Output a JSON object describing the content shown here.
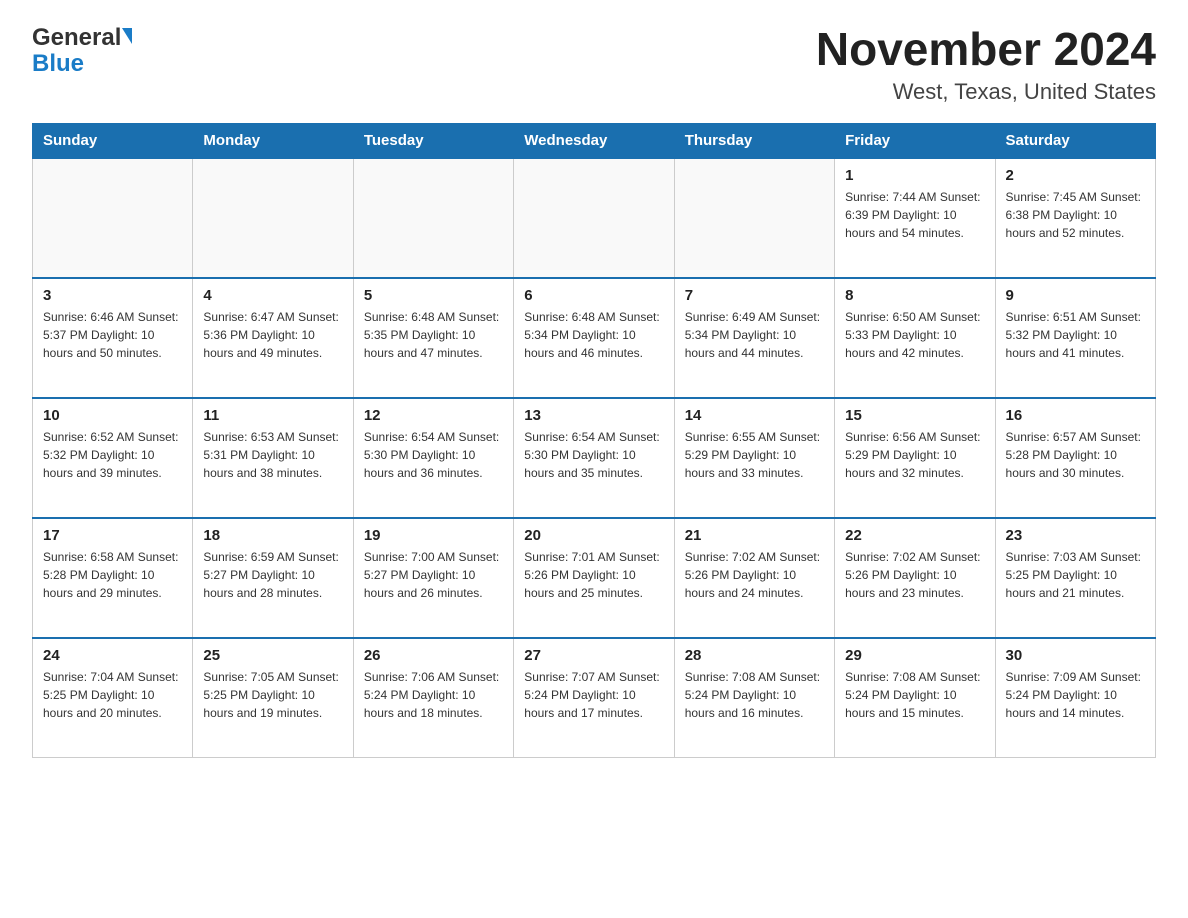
{
  "logo": {
    "general": "General",
    "blue": "Blue"
  },
  "title": "November 2024",
  "location": "West, Texas, United States",
  "days_of_week": [
    "Sunday",
    "Monday",
    "Tuesday",
    "Wednesday",
    "Thursday",
    "Friday",
    "Saturday"
  ],
  "weeks": [
    [
      {
        "day": "",
        "info": ""
      },
      {
        "day": "",
        "info": ""
      },
      {
        "day": "",
        "info": ""
      },
      {
        "day": "",
        "info": ""
      },
      {
        "day": "",
        "info": ""
      },
      {
        "day": "1",
        "info": "Sunrise: 7:44 AM\nSunset: 6:39 PM\nDaylight: 10 hours and 54 minutes."
      },
      {
        "day": "2",
        "info": "Sunrise: 7:45 AM\nSunset: 6:38 PM\nDaylight: 10 hours and 52 minutes."
      }
    ],
    [
      {
        "day": "3",
        "info": "Sunrise: 6:46 AM\nSunset: 5:37 PM\nDaylight: 10 hours and 50 minutes."
      },
      {
        "day": "4",
        "info": "Sunrise: 6:47 AM\nSunset: 5:36 PM\nDaylight: 10 hours and 49 minutes."
      },
      {
        "day": "5",
        "info": "Sunrise: 6:48 AM\nSunset: 5:35 PM\nDaylight: 10 hours and 47 minutes."
      },
      {
        "day": "6",
        "info": "Sunrise: 6:48 AM\nSunset: 5:34 PM\nDaylight: 10 hours and 46 minutes."
      },
      {
        "day": "7",
        "info": "Sunrise: 6:49 AM\nSunset: 5:34 PM\nDaylight: 10 hours and 44 minutes."
      },
      {
        "day": "8",
        "info": "Sunrise: 6:50 AM\nSunset: 5:33 PM\nDaylight: 10 hours and 42 minutes."
      },
      {
        "day": "9",
        "info": "Sunrise: 6:51 AM\nSunset: 5:32 PM\nDaylight: 10 hours and 41 minutes."
      }
    ],
    [
      {
        "day": "10",
        "info": "Sunrise: 6:52 AM\nSunset: 5:32 PM\nDaylight: 10 hours and 39 minutes."
      },
      {
        "day": "11",
        "info": "Sunrise: 6:53 AM\nSunset: 5:31 PM\nDaylight: 10 hours and 38 minutes."
      },
      {
        "day": "12",
        "info": "Sunrise: 6:54 AM\nSunset: 5:30 PM\nDaylight: 10 hours and 36 minutes."
      },
      {
        "day": "13",
        "info": "Sunrise: 6:54 AM\nSunset: 5:30 PM\nDaylight: 10 hours and 35 minutes."
      },
      {
        "day": "14",
        "info": "Sunrise: 6:55 AM\nSunset: 5:29 PM\nDaylight: 10 hours and 33 minutes."
      },
      {
        "day": "15",
        "info": "Sunrise: 6:56 AM\nSunset: 5:29 PM\nDaylight: 10 hours and 32 minutes."
      },
      {
        "day": "16",
        "info": "Sunrise: 6:57 AM\nSunset: 5:28 PM\nDaylight: 10 hours and 30 minutes."
      }
    ],
    [
      {
        "day": "17",
        "info": "Sunrise: 6:58 AM\nSunset: 5:28 PM\nDaylight: 10 hours and 29 minutes."
      },
      {
        "day": "18",
        "info": "Sunrise: 6:59 AM\nSunset: 5:27 PM\nDaylight: 10 hours and 28 minutes."
      },
      {
        "day": "19",
        "info": "Sunrise: 7:00 AM\nSunset: 5:27 PM\nDaylight: 10 hours and 26 minutes."
      },
      {
        "day": "20",
        "info": "Sunrise: 7:01 AM\nSunset: 5:26 PM\nDaylight: 10 hours and 25 minutes."
      },
      {
        "day": "21",
        "info": "Sunrise: 7:02 AM\nSunset: 5:26 PM\nDaylight: 10 hours and 24 minutes."
      },
      {
        "day": "22",
        "info": "Sunrise: 7:02 AM\nSunset: 5:26 PM\nDaylight: 10 hours and 23 minutes."
      },
      {
        "day": "23",
        "info": "Sunrise: 7:03 AM\nSunset: 5:25 PM\nDaylight: 10 hours and 21 minutes."
      }
    ],
    [
      {
        "day": "24",
        "info": "Sunrise: 7:04 AM\nSunset: 5:25 PM\nDaylight: 10 hours and 20 minutes."
      },
      {
        "day": "25",
        "info": "Sunrise: 7:05 AM\nSunset: 5:25 PM\nDaylight: 10 hours and 19 minutes."
      },
      {
        "day": "26",
        "info": "Sunrise: 7:06 AM\nSunset: 5:24 PM\nDaylight: 10 hours and 18 minutes."
      },
      {
        "day": "27",
        "info": "Sunrise: 7:07 AM\nSunset: 5:24 PM\nDaylight: 10 hours and 17 minutes."
      },
      {
        "day": "28",
        "info": "Sunrise: 7:08 AM\nSunset: 5:24 PM\nDaylight: 10 hours and 16 minutes."
      },
      {
        "day": "29",
        "info": "Sunrise: 7:08 AM\nSunset: 5:24 PM\nDaylight: 10 hours and 15 minutes."
      },
      {
        "day": "30",
        "info": "Sunrise: 7:09 AM\nSunset: 5:24 PM\nDaylight: 10 hours and 14 minutes."
      }
    ]
  ]
}
